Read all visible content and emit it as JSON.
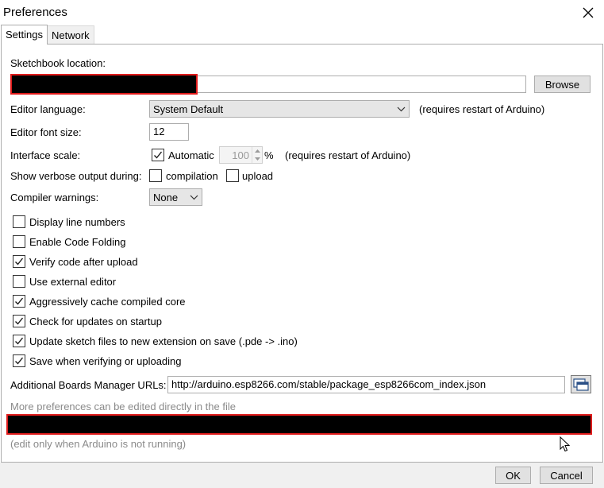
{
  "window": {
    "title": "Preferences"
  },
  "tabs": [
    {
      "label": "Settings",
      "active": true
    },
    {
      "label": "Network",
      "active": false
    }
  ],
  "settings": {
    "sketchbook": {
      "label": "Sketchbook location:",
      "value": "",
      "browse_label": "Browse"
    },
    "editor_language": {
      "label": "Editor language:",
      "selected": "System Default",
      "note": "(requires restart of Arduino)"
    },
    "editor_font_size": {
      "label": "Editor font size:",
      "value": "12"
    },
    "interface_scale": {
      "label": "Interface scale:",
      "automatic_label": "Automatic",
      "automatic_checked": true,
      "value": "100",
      "unit": "%",
      "note": "(requires restart of Arduino)"
    },
    "verbose": {
      "label": "Show verbose output during:",
      "compilation_label": "compilation",
      "compilation_checked": false,
      "upload_label": "upload",
      "upload_checked": false
    },
    "compiler_warnings": {
      "label": "Compiler warnings:",
      "selected": "None"
    },
    "options": [
      {
        "label": "Display line numbers",
        "checked": false
      },
      {
        "label": "Enable Code Folding",
        "checked": false
      },
      {
        "label": "Verify code after upload",
        "checked": true
      },
      {
        "label": "Use external editor",
        "checked": false
      },
      {
        "label": "Aggressively cache compiled core",
        "checked": true
      },
      {
        "label": "Check for updates on startup",
        "checked": true
      },
      {
        "label": "Update sketch files to new extension on save (.pde -> .ino)",
        "checked": true
      },
      {
        "label": "Save when verifying or uploading",
        "checked": true
      }
    ],
    "boards_manager": {
      "label": "Additional Boards Manager URLs:",
      "value": "http://arduino.esp8266.com/stable/package_esp8266com_index.json"
    },
    "more_prefs_text": "More preferences can be edited directly in the file",
    "prefs_path": "",
    "edit_note": "(edit only when Arduino is not running)"
  },
  "footer": {
    "ok_label": "OK",
    "cancel_label": "Cancel"
  },
  "colors": {
    "redaction_border": "#e01b1b",
    "checkbox_mark": "#1a1a1a"
  },
  "icons": {
    "close": "close-icon",
    "url-list": "window-list-icon",
    "cursor": "mouse-cursor-icon"
  }
}
